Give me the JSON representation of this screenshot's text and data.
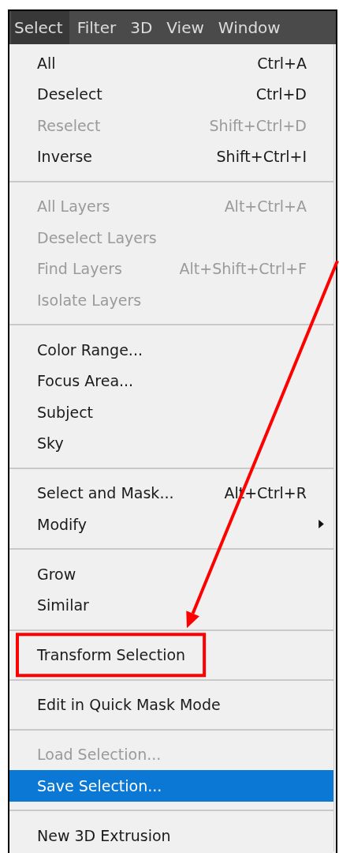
{
  "menu_bar": [
    {
      "label": "Select",
      "selected": true
    },
    {
      "label": "Filter",
      "selected": false
    },
    {
      "label": "3D",
      "selected": false
    },
    {
      "label": "View",
      "selected": false
    },
    {
      "label": "Window",
      "selected": false
    }
  ],
  "menu_groups": [
    [
      {
        "label": "All",
        "shortcut": "Ctrl+A",
        "kind": "command",
        "disabled": false,
        "selected": false,
        "annotated": false
      },
      {
        "label": "Deselect",
        "shortcut": "Ctrl+D",
        "kind": "command",
        "disabled": false,
        "selected": false,
        "annotated": false
      },
      {
        "label": "Reselect",
        "shortcut": "Shift+Ctrl+D",
        "kind": "command",
        "disabled": true,
        "selected": false,
        "annotated": false
      },
      {
        "label": "Inverse",
        "shortcut": "Shift+Ctrl+I",
        "kind": "command",
        "disabled": false,
        "selected": false,
        "annotated": false
      }
    ],
    [
      {
        "label": "All Layers",
        "shortcut": "Alt+Ctrl+A",
        "kind": "command",
        "disabled": true,
        "selected": false,
        "annotated": false
      },
      {
        "label": "Deselect Layers",
        "kind": "command",
        "disabled": true,
        "selected": false,
        "annotated": false
      },
      {
        "label": "Find Layers",
        "shortcut": "Alt+Shift+Ctrl+F",
        "kind": "command",
        "disabled": true,
        "selected": false,
        "annotated": false
      },
      {
        "label": "Isolate Layers",
        "kind": "command",
        "disabled": true,
        "selected": false,
        "annotated": false
      }
    ],
    [
      {
        "label": "Color Range...",
        "kind": "command",
        "disabled": false,
        "selected": false,
        "annotated": false
      },
      {
        "label": "Focus Area...",
        "kind": "command",
        "disabled": false,
        "selected": false,
        "annotated": false
      },
      {
        "label": "Subject",
        "kind": "command",
        "disabled": false,
        "selected": false,
        "annotated": false
      },
      {
        "label": "Sky",
        "kind": "command",
        "disabled": false,
        "selected": false,
        "annotated": false
      }
    ],
    [
      {
        "label": "Select and Mask...",
        "shortcut": "Alt+Ctrl+R",
        "kind": "command",
        "disabled": false,
        "selected": false,
        "annotated": false
      },
      {
        "label": "Modify",
        "kind": "submenu",
        "disabled": false,
        "selected": false,
        "annotated": false
      }
    ],
    [
      {
        "label": "Grow",
        "kind": "command",
        "disabled": false,
        "selected": false,
        "annotated": false
      },
      {
        "label": "Similar",
        "kind": "command",
        "disabled": false,
        "selected": false,
        "annotated": false
      }
    ],
    [
      {
        "label": "Transform Selection",
        "kind": "command",
        "disabled": false,
        "selected": false,
        "annotated": true
      }
    ],
    [
      {
        "label": "Edit in Quick Mask Mode",
        "kind": "command",
        "disabled": false,
        "selected": false,
        "annotated": false
      }
    ],
    [
      {
        "label": "Load Selection...",
        "kind": "command",
        "disabled": true,
        "selected": false,
        "annotated": false
      },
      {
        "label": "Save Selection...",
        "kind": "command",
        "disabled": false,
        "selected": true,
        "annotated": false
      }
    ],
    [
      {
        "label": "New 3D Extrusion",
        "kind": "command",
        "disabled": false,
        "selected": false,
        "annotated": false
      }
    ]
  ]
}
